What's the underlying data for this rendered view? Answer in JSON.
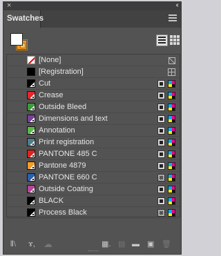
{
  "panel": {
    "close_glyph": "×",
    "collapse_glyph": "‹‹",
    "tab_label": "Swatches"
  },
  "swatches": [
    {
      "name": "[None]",
      "color": "#ffffff",
      "kind": "none",
      "ind1": null,
      "ind2": "non-editable"
    },
    {
      "name": "[Registration]",
      "color": "#000000",
      "kind": "registration",
      "ind1": null,
      "ind2": "registration"
    },
    {
      "name": "Cut",
      "color": "#000000",
      "kind": "spot",
      "ind1": "spot",
      "ind2": "cmyk"
    },
    {
      "name": "Crease",
      "color": "#e8242b",
      "kind": "spot",
      "ind1": "spot",
      "ind2": "cmyk"
    },
    {
      "name": "Outside Bleed",
      "color": "#3e9a3a",
      "kind": "spot",
      "ind1": "spot",
      "ind2": "cmyk"
    },
    {
      "name": "Dimensions and text",
      "color": "#7a3f9c",
      "kind": "spot",
      "ind1": "spot",
      "ind2": "cmyk"
    },
    {
      "name": "Annotation",
      "color": "#5ab948",
      "kind": "spot",
      "ind1": "spot",
      "ind2": "cmyk"
    },
    {
      "name": "Print registration",
      "color": "#4f7d88",
      "kind": "spot",
      "ind1": "spot",
      "ind2": "cmyk"
    },
    {
      "name": "PANTONE 485 C",
      "color": "#e2231a",
      "kind": "spot",
      "ind1": "spot",
      "ind2": "cmyk"
    },
    {
      "name": "Pantone 4879",
      "color": "#f79c2a",
      "kind": "spot",
      "ind1": "spot",
      "ind2": "cmyk"
    },
    {
      "name": "PANTONE 660 C",
      "color": "#2c5fb0",
      "kind": "spot",
      "ind1": "spot-hatched",
      "ind2": "cmyk"
    },
    {
      "name": "Outside Coating",
      "color": "#b8449a",
      "kind": "spot",
      "ind1": "spot",
      "ind2": "cmyk"
    },
    {
      "name": "BLACK",
      "color": "#000000",
      "kind": "spot",
      "ind1": "spot",
      "ind2": "cmyk"
    },
    {
      "name": "Process Black",
      "color": "#000000",
      "kind": "process",
      "ind1": "spot-hatched",
      "ind2": "cmyk"
    }
  ],
  "icons": {
    "library": "library-icon",
    "show_kinds": "show-swatch-kinds-icon",
    "cloud": "cloud-icon",
    "swatch_options": "swatch-options-icon",
    "color_group": "new-color-group-icon",
    "folder": "folder-icon",
    "new_swatch": "new-swatch-icon",
    "delete": "trash-icon"
  },
  "glyphs": {
    "library": "⫴⧵",
    "show_kinds": "ɤ,",
    "cloud": "☁",
    "swatch_options": "▦.",
    "color_group": "▤",
    "folder": "▬",
    "new_swatch": "▣",
    "trash": "🗑"
  },
  "accent_colors": {
    "panel_bg": "#535353",
    "titlebar_bg": "#3d3d3d",
    "stroke_orange": "#f3a018"
  }
}
